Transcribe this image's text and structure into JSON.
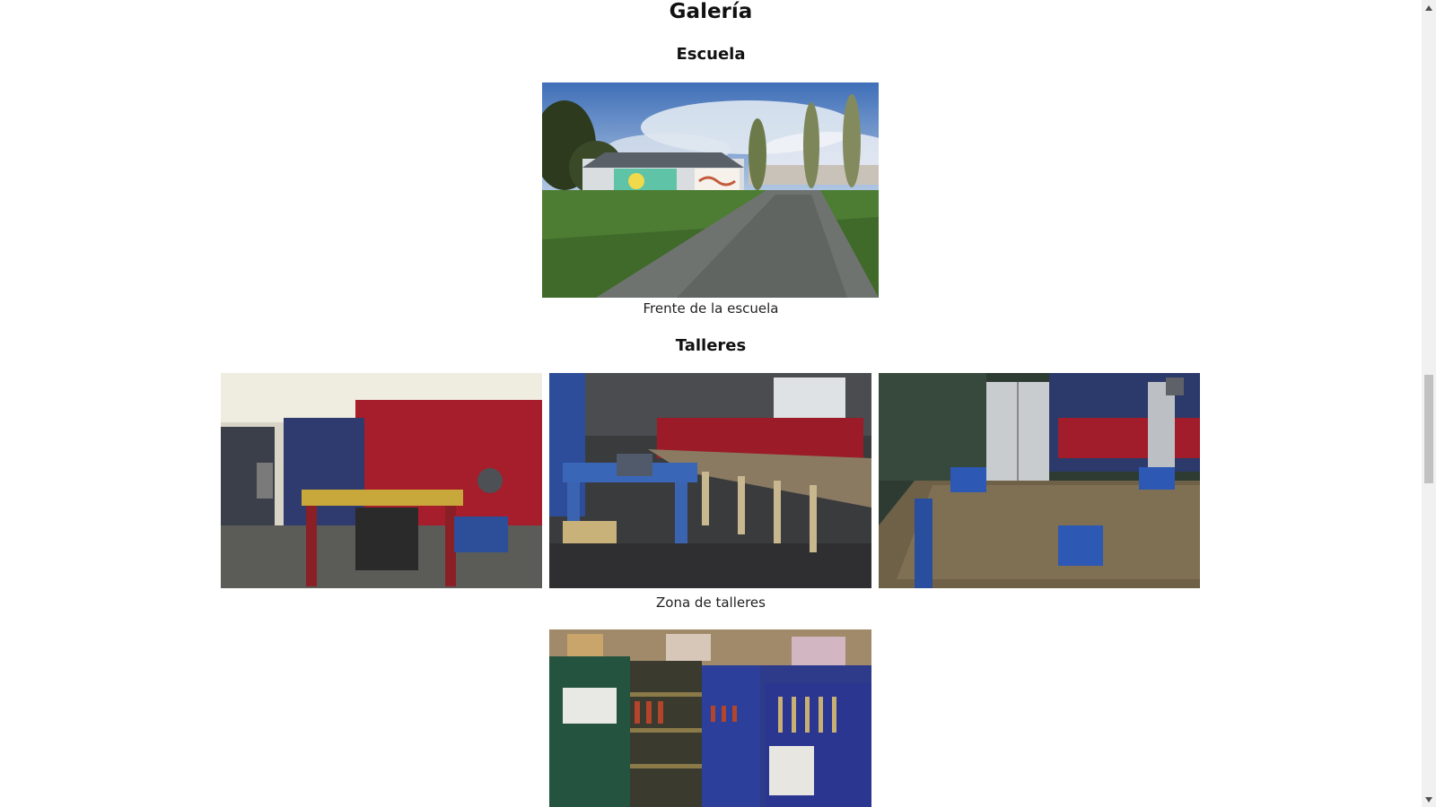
{
  "gallery": {
    "title": "Galería",
    "sections": [
      {
        "heading": "Escuela",
        "caption": "Frente de la escuela",
        "photos": [
          {
            "name": "school-front-photo"
          }
        ]
      },
      {
        "heading": "Talleres",
        "caption": "Zona de talleres",
        "photos": [
          {
            "name": "workshop-photo-red-wall"
          },
          {
            "name": "workshop-photo-tables"
          },
          {
            "name": "workshop-photo-workbench"
          },
          {
            "name": "workshop-photo-tools"
          }
        ]
      }
    ]
  },
  "colors": {
    "background": "#ffffff",
    "text": "#111111",
    "scrollbar_track": "#f1f1f1",
    "scrollbar_thumb": "#c1c1c1"
  },
  "icons": {
    "scroll_up": "scroll-up-arrow-icon",
    "scroll_down": "scroll-down-arrow-icon"
  }
}
